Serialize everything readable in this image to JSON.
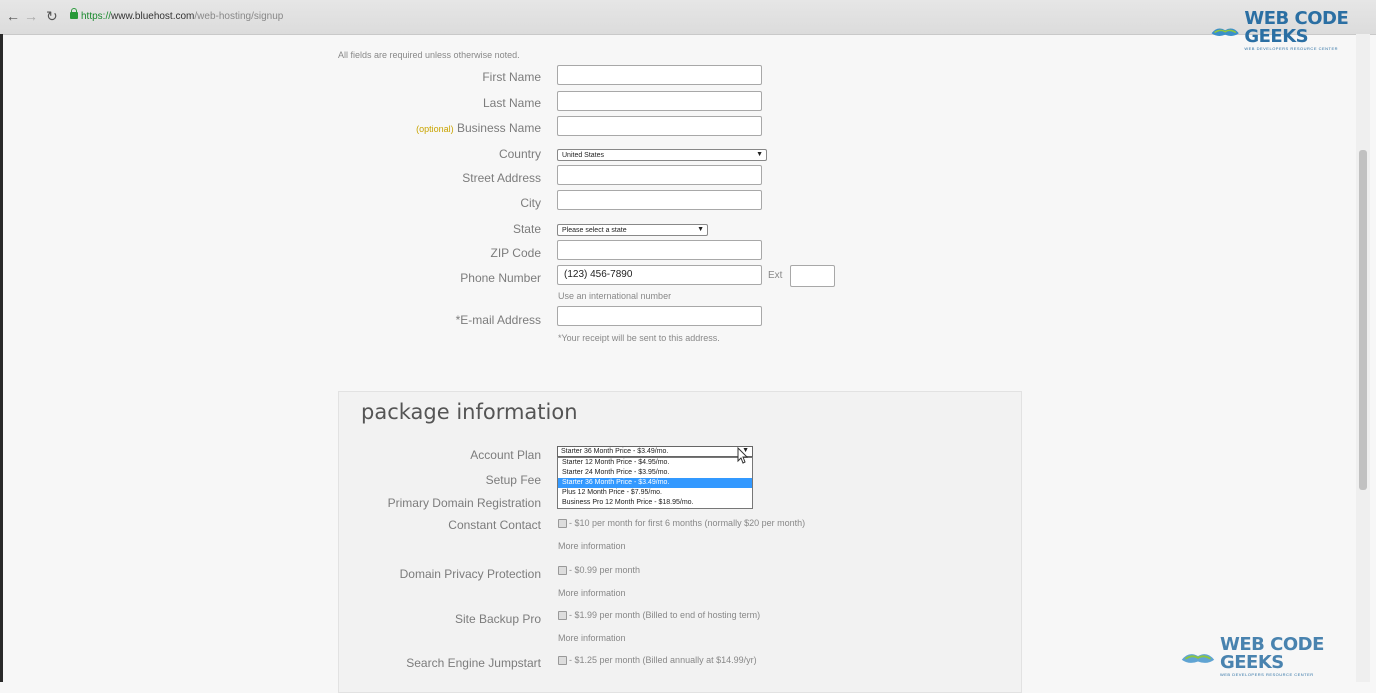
{
  "browser": {
    "back_icon": "back-arrow-icon",
    "forward_icon": "forward-arrow-icon",
    "reload_icon": "reload-icon",
    "url_scheme": "https://",
    "url_host": "www.bluehost.com",
    "url_path": "/web-hosting/signup"
  },
  "watermark": {
    "title": "WEB CODE GEEKS",
    "subtitle": "WEB DEVELOPERS RESOURCE CENTER"
  },
  "form": {
    "required_note": "All fields are required unless otherwise noted.",
    "first_name_label": "First Name",
    "last_name_label": "Last Name",
    "business_optional": "(optional)",
    "business_name_label": "Business Name",
    "country_label": "Country",
    "country_value": "United States",
    "street_label": "Street Address",
    "city_label": "City",
    "state_label": "State",
    "state_value": "Please select a state",
    "zip_label": "ZIP Code",
    "phone_label": "Phone Number",
    "phone_value": "(123) 456-7890",
    "ext_label": "Ext",
    "phone_help": "Use an international number",
    "email_label": "*E-mail Address",
    "email_help": "*Your receipt will be sent to this address."
  },
  "package": {
    "title": "package information",
    "account_plan_label": "Account Plan",
    "account_plan_value": "Starter 36 Month Price - $3.49/mo.",
    "plan_options": [
      "Starter 12 Month Price - $4.95/mo.",
      "Starter 24 Month Price - $3.95/mo.",
      "Starter 36 Month Price - $3.49/mo.",
      "Plus 12 Month Price - $7.95/mo.",
      "Business Pro 12 Month Price - $18.95/mo."
    ],
    "selected_plan_index": 2,
    "setup_fee_label": "Setup Fee",
    "primary_domain_label": "Primary Domain Registration",
    "constant_contact_label": "Constant Contact",
    "constant_contact_text": "- $10 per month for first 6 months (normally $20 per month)",
    "privacy_label": "Domain Privacy Protection",
    "privacy_text": "- $0.99 per month",
    "backup_label": "Site Backup Pro",
    "backup_text": "- $1.99 per month (Billed to end of hosting term)",
    "jumpstart_label": "Search Engine Jumpstart",
    "jumpstart_text": "- $1.25 per month (Billed annually at $14.99/yr)",
    "more_info": "More information"
  }
}
